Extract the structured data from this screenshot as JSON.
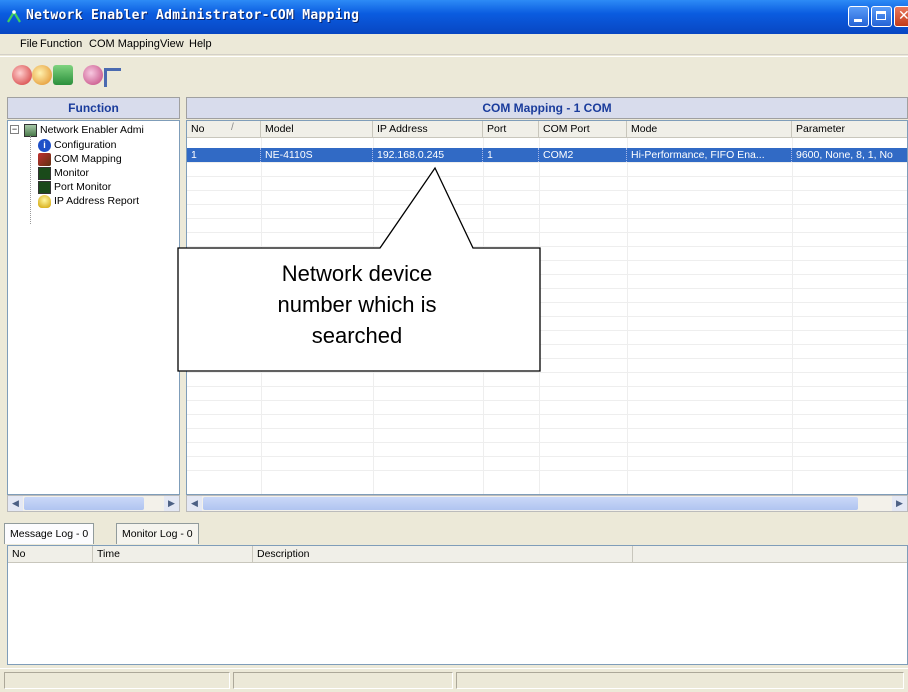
{
  "window": {
    "title": "Network Enabler Administrator-COM Mapping",
    "controls": {
      "minimize_icon": "minimize-icon",
      "maximize_icon": "maximize-icon",
      "close_icon": "close-icon"
    }
  },
  "menu": [
    {
      "label": "File"
    },
    {
      "label": "Function"
    },
    {
      "label": "COM Mapping"
    },
    {
      "label": "View"
    },
    {
      "label": "Help"
    }
  ],
  "toolbar": [
    {
      "icon": "search-icon"
    },
    {
      "icon": "refresh-icon"
    },
    {
      "icon": "map-icon"
    },
    {
      "icon": "settings-icon"
    },
    {
      "icon": "tool-icon"
    }
  ],
  "left_panel": {
    "header": "Function",
    "tree": [
      {
        "label": "Network Enabler Admi",
        "icon": "network-icon",
        "level": 0
      },
      {
        "label": "Configuration",
        "icon": "info-icon",
        "level": 1
      },
      {
        "label": "COM Mapping",
        "icon": "com-mapping-icon",
        "level": 1
      },
      {
        "label": "Monitor",
        "icon": "monitor-icon",
        "level": 1
      },
      {
        "label": "Port Monitor",
        "icon": "port-monitor-icon",
        "level": 1
      },
      {
        "label": "IP Address Report",
        "icon": "lightbulb-icon",
        "level": 1
      }
    ]
  },
  "main_panel": {
    "header": "COM Mapping - 1 COM",
    "columns": [
      "No",
      "Model",
      "IP Address",
      "Port",
      "COM Port",
      "Mode",
      "Parameter"
    ],
    "rows": [
      [
        "1",
        "NE-4110S",
        "192.168.0.245",
        "1",
        "COM2",
        "Hi-Performance, FIFO Ena...",
        "9600, None, 8, 1, No"
      ]
    ]
  },
  "callout": {
    "text_lines": [
      "Network device",
      "number which is",
      "searched"
    ]
  },
  "log": {
    "tabs": [
      {
        "label": "Message Log - 0"
      },
      {
        "label": "Monitor Log - 0"
      }
    ],
    "columns": [
      "No",
      "Time",
      "Description"
    ]
  },
  "colors": {
    "titlebar": "#0a5ce0",
    "selection": "#316ac5",
    "header_text": "#1a3c9c"
  }
}
